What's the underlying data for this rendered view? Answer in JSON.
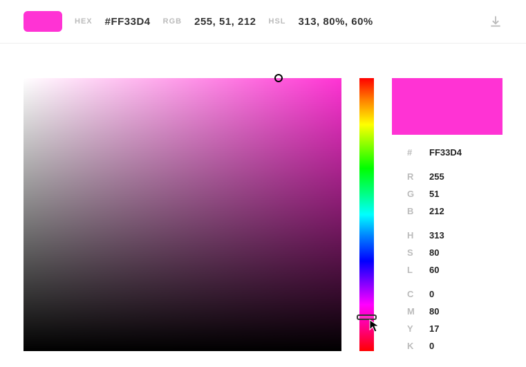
{
  "color": {
    "hex": "#FF33D4",
    "hex_noprefix": "FF33D4",
    "rgb_string": "255, 51, 212",
    "hsl_string": "313, 80%, 60%",
    "r": "255",
    "g": "51",
    "b": "212",
    "h": "313",
    "s": "80",
    "l": "60",
    "c": "0",
    "m": "80",
    "y": "17",
    "k": "0"
  },
  "labels": {
    "hex": "HEX",
    "rgb": "RGB",
    "hsl": "HSL",
    "hash": "#",
    "r": "R",
    "g": "G",
    "b": "B",
    "h": "H",
    "s": "S",
    "l": "L",
    "c": "C",
    "m": "M",
    "y": "Y",
    "k": "K"
  }
}
